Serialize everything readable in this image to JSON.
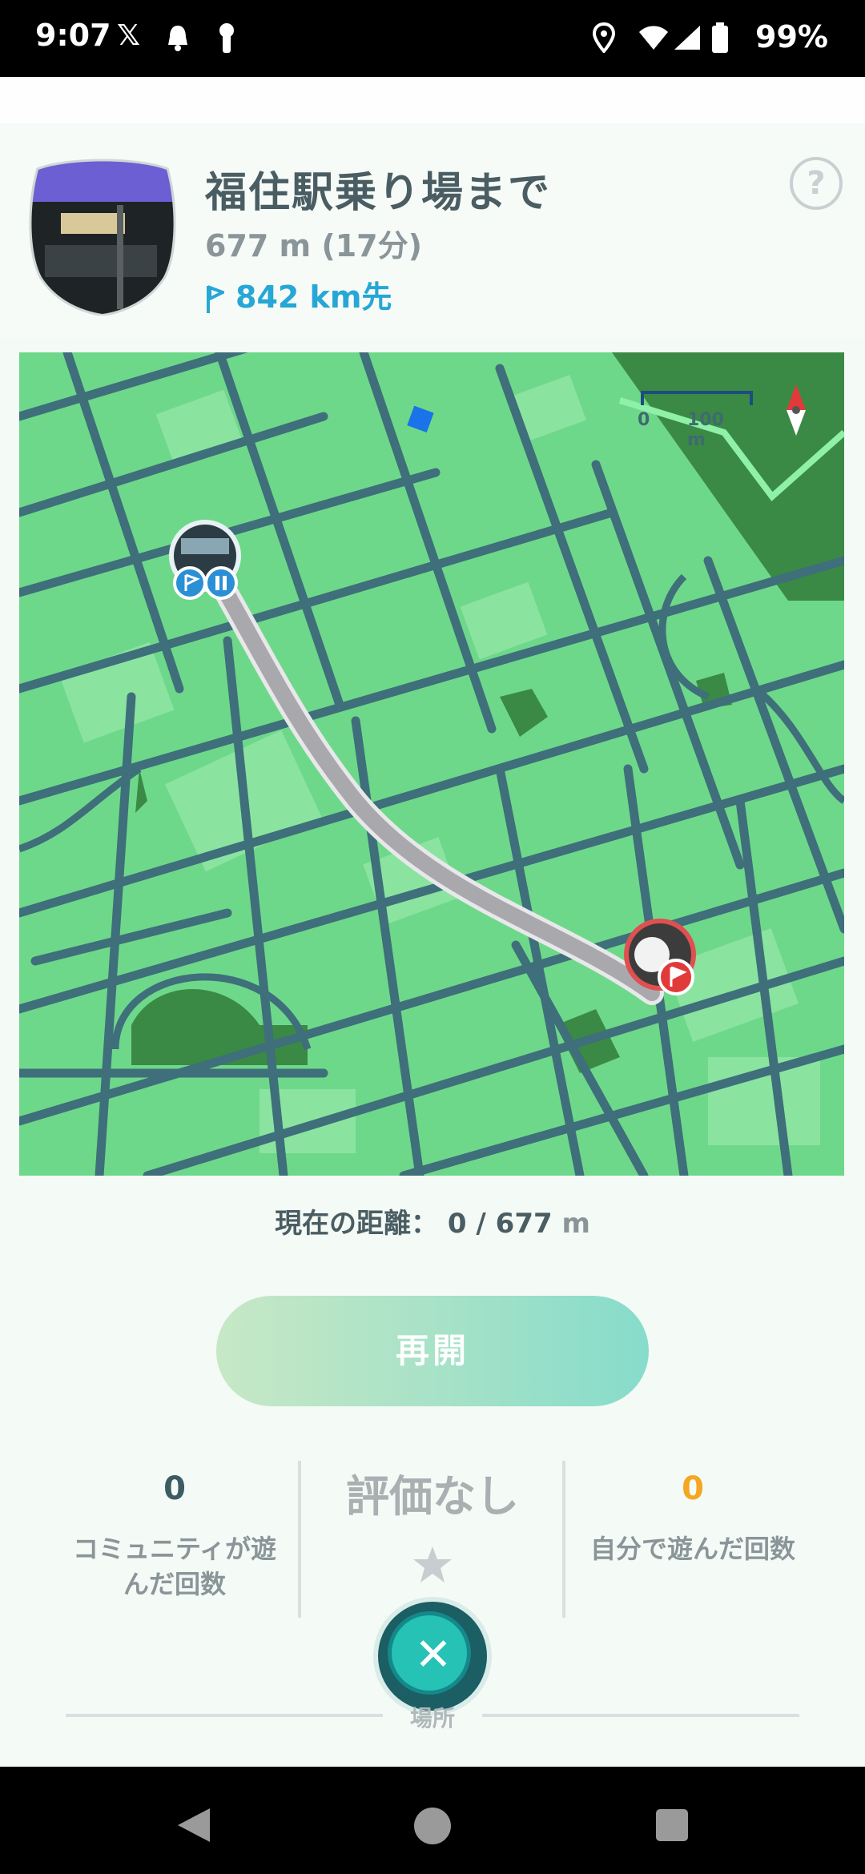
{
  "status_bar": {
    "time": "9:07",
    "left_icons": [
      "x-logo-icon",
      "bell-icon",
      "key-icon"
    ],
    "right_icons": [
      "location-icon",
      "wifi-icon",
      "signal-icon",
      "battery-icon"
    ],
    "battery": "99%"
  },
  "route": {
    "title": "福住駅乗り場まで",
    "distance": "677 m (17分)",
    "flag_distance": "842 km先",
    "help": "?"
  },
  "map": {
    "scale_start": "0",
    "scale_end": "100 m",
    "colors": {
      "land": "#6ed88a",
      "road": "#3e6f7a",
      "park": "#3a8a45",
      "route": "#a9a9ad"
    }
  },
  "progress": {
    "label": "現在の距離：",
    "value": "0 / 677",
    "unit": "m"
  },
  "resume_button": "再開",
  "stats": {
    "community_count": "0",
    "community_label_line1": "コミュニティが遊",
    "community_label_line2": "んだ回数",
    "rating": "評価なし",
    "self_count": "0",
    "self_label": "自分で遊んだ回数"
  },
  "bottom": {
    "place_label": "場所"
  },
  "accent_colors": {
    "flag_blue": "#26a7d5",
    "orange": "#f5a623",
    "teal": "#26c2b5"
  }
}
